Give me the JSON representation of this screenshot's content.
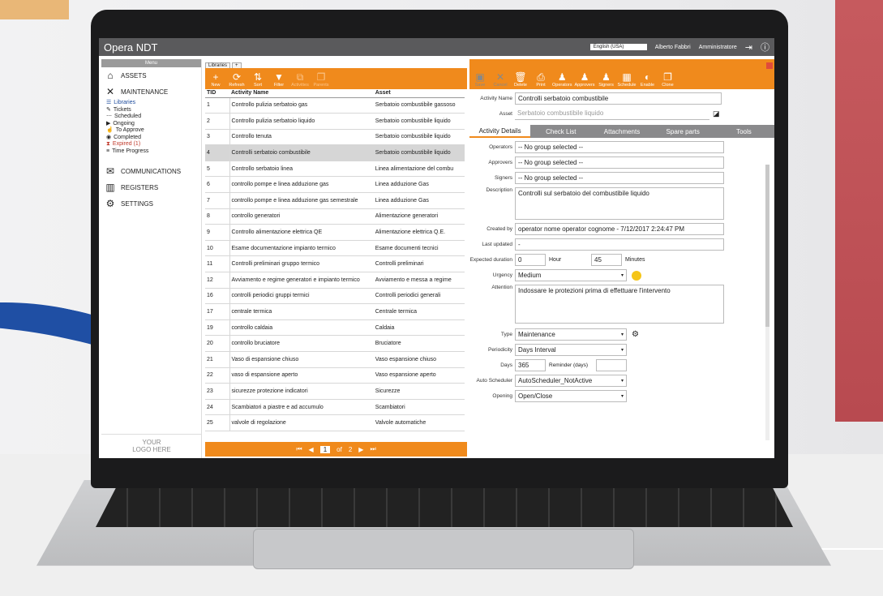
{
  "app": {
    "title": "Opera NDT",
    "language": "English (USA)",
    "user": "Alberto Fabbri",
    "role": "Amministratore"
  },
  "sidebar": {
    "header": "Menu",
    "assets": "ASSETS",
    "maintenance": "MAINTENANCE",
    "sub": [
      "Libraries",
      "Tickets",
      "Scheduled",
      "Ongoing",
      "To Approve",
      "Completed",
      "Expired (1)",
      "Time Progress"
    ],
    "communications": "COMMUNICATIONS",
    "registers": "REGISTERS",
    "settings": "SETTINGS",
    "logo": [
      "YOUR",
      "LOGO HERE"
    ]
  },
  "list": {
    "tab": "Libraries",
    "toolbar": [
      "New",
      "Refresh",
      "Sort",
      "Filter",
      "Activities",
      "Parents"
    ],
    "headers": [
      "TID",
      "Activity Name",
      "Asset"
    ],
    "rows": [
      [
        "1",
        "Controllo pulizia serbatoio gas",
        "Serbatoio combustibile gassoso"
      ],
      [
        "2",
        "Controllo pulizia serbatoio liquido",
        "Serbatoio combustibile liquido"
      ],
      [
        "3",
        "Controllo tenuta",
        "Serbatoio combustibile liquido"
      ],
      [
        "4",
        "Controlli serbatoio combustibile",
        "Serbatoio combustibile liquido"
      ],
      [
        "5",
        "Controllo serbatoio linea",
        "Linea alimentazione del combu"
      ],
      [
        "6",
        "controllo pompe e linea adduzione gas",
        "Linea adduzione Gas"
      ],
      [
        "7",
        "controllo pompe e linea adduzione gas semestrale",
        "Linea adduzione Gas"
      ],
      [
        "8",
        "controllo generatori",
        "Alimentazione generatori"
      ],
      [
        "9",
        "Controllo alimentazione elettrica QE",
        "Alimentazione elettrica Q.E."
      ],
      [
        "10",
        "Esame documentazione impianto termico",
        "Esame documenti tecnici"
      ],
      [
        "11",
        "Controlli preliminari gruppo termico",
        "Controlli preliminari"
      ],
      [
        "12",
        "Avviamento e regime generatori e impianto termico",
        "Avviamento e messa a regime"
      ],
      [
        "16",
        "controlli periodici gruppi termici",
        "Controlli periodici generali"
      ],
      [
        "17",
        "centrale termica",
        "Centrale termica"
      ],
      [
        "19",
        "controllo caldaia",
        "Caldaia"
      ],
      [
        "20",
        "controllo bruciatore",
        "Bruciatore"
      ],
      [
        "21",
        "Vaso di espansione chiuso",
        "Vaso espansione chiuso"
      ],
      [
        "22",
        "vaso di espansione aperto",
        "Vaso espansione aperto"
      ],
      [
        "23",
        "sicurezze protezione indicatori",
        "Sicurezze"
      ],
      [
        "24",
        "Scambiatori a piastre e ad accumulo",
        "Scambiatori"
      ],
      [
        "25",
        "valvole di regolazione",
        "Valvole automatiche"
      ]
    ],
    "selected_tid": "4",
    "pager": {
      "page": "1",
      "of": "of",
      "total": "2"
    }
  },
  "detail": {
    "toolbar": [
      "Save",
      "Cancel",
      "Delete",
      "Print",
      "Operators",
      "Approvers",
      "Signers",
      "Schedule",
      "Enable",
      "Clone"
    ],
    "activity_name_label": "Activity Name",
    "activity_name": "Controlli serbatoio combustibile",
    "asset_label": "Asset",
    "asset": "Serbatoio combustibile liquido",
    "tabs": [
      "Activity Details",
      "Check List",
      "Attachments",
      "Spare parts",
      "Tools"
    ],
    "operators_label": "Operators",
    "operators": "-- No group selected --",
    "approvers_label": "Approvers",
    "approvers": "-- No group selected --",
    "signers_label": "Signers",
    "signers": "-- No group selected --",
    "description_label": "Description",
    "description": "Controlli sul serbatoio del combustibile liquido",
    "created_label": "Created by",
    "created": "operator nome operator cognome - 7/12/2017 2:24:47 PM",
    "updated_label": "Last updated",
    "updated": "-",
    "duration_label": "Expected duration",
    "hours": "0",
    "hour_label": "Hour",
    "minutes": "45",
    "minutes_label": "Minutes",
    "urgency_label": "Urgency",
    "urgency": "Medium",
    "attention_label": "Attention",
    "attention": "Indossare le protezioni prima di effettuare l'intervento",
    "type_label": "Type",
    "type": "Maintenance",
    "periodicity_label": "Periodicity",
    "periodicity": "Days Interval",
    "days_label": "Days",
    "days": "365",
    "reminder_label": "Reminder (days)",
    "auto_label": "Auto Scheduler",
    "auto": "AutoScheduler_NotActive",
    "opening_label": "Opening",
    "opening": "Open/Close"
  },
  "colors": {
    "accent": "#f08a1c",
    "titlebar": "#5a5a5c",
    "selected_row": "#d6d6d6",
    "urgency_dot": "#f5c518"
  }
}
